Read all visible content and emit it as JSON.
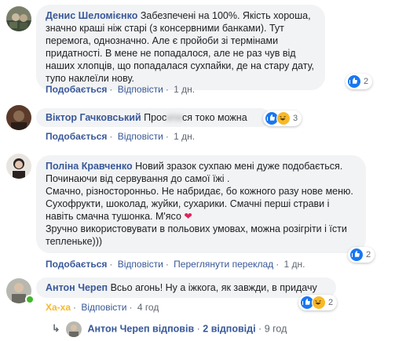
{
  "comments": [
    {
      "name": "Денис Шеломієнко",
      "text": "Забезпечені на 100%. Якість хороша, значно краші ніж старі (з консервними банками). Тут перемога, однозначно. Але є пройоби зі термінами придатності. В мене не попадалося, але не раз чув від наших хлопців, що попадалася сухпайки, де на стару дату, тупо наклеїли нову.",
      "actions": {
        "like": "Подобається",
        "reply": "Відповісти",
        "time": "1 дн."
      },
      "reactions": {
        "count": "2",
        "icons": [
          "like-icon"
        ]
      }
    },
    {
      "name": "Віктор Гачковський",
      "text_visible": "Прос",
      "text_blurred": "ити",
      "text_end": "ся токо можна",
      "actions": {
        "like": "Подобається",
        "reply": "Відповісти",
        "time": "1 дн."
      },
      "reactions": {
        "count": "3",
        "icons": [
          "like-icon",
          "haha-icon"
        ]
      }
    },
    {
      "name": "Поліна Кравченко",
      "text": "Новий зразок сухпаю мені дуже подобається. Починаючи від сервування до самої їжі .\nСмачно, різносторонньо. Не набридає, бо кожного разу нове меню. Сухофрукти, шоколад, жуйки, сухарики. Смачні перші страви і навіть смачна тушонка. М'ясо",
      "text2": "Зручно використовувати в польових умовах, можна розігріти і їсти тепленьке)))",
      "actions": {
        "like": "Подобається",
        "reply": "Відповісти",
        "translate": "Переглянути переклад",
        "time": "1 дн."
      },
      "reactions": {
        "count": "2",
        "icons": [
          "like-icon"
        ]
      }
    },
    {
      "name": "Антон Череп",
      "text": "Всьо агонь! Ну а іжкога, як завжди, в придачу",
      "actions": {
        "like": "Ха-ха",
        "reply": "Відповісти",
        "time": "4 год"
      },
      "reactions": {
        "count": "2",
        "icons": [
          "like-icon",
          "haha-icon"
        ]
      }
    }
  ],
  "reply_summary": {
    "name": "Антон Череп",
    "verb": "відповів",
    "dot": "·",
    "count": "2 відповіді",
    "time": "9 год"
  },
  "colors": {
    "link": "#385898",
    "bubble": "#f2f3f5",
    "like": "#1877f2",
    "haha": "#f7b928",
    "heart": "#e0245e"
  }
}
